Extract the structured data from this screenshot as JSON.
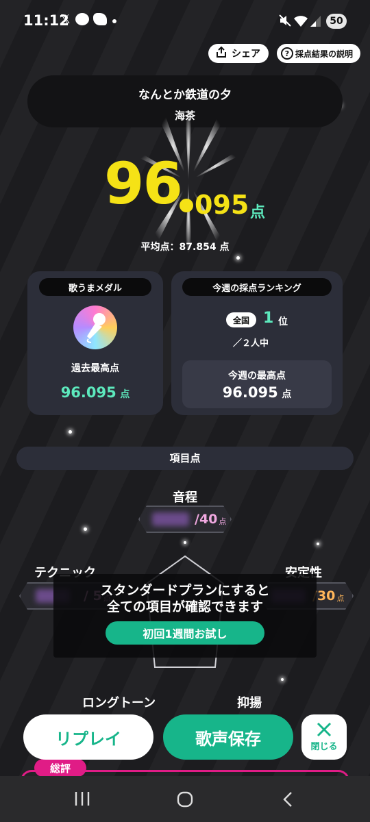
{
  "status_bar": {
    "time": "11:12",
    "app_icons": [
      "x-icon",
      "line-icon",
      "bird-icon"
    ],
    "battery": "50"
  },
  "header": {
    "share_label": "シェア",
    "explain_label": "採点結果の説明"
  },
  "song": {
    "title": "なんとか鉄道の夕",
    "artist": "海茶"
  },
  "score": {
    "integer": "96",
    "decimal": "095",
    "unit": "点",
    "average": "平均点：87.854 点"
  },
  "medal_card": {
    "tag": "歌うまメダル",
    "best_label": "過去最高点",
    "best_value": "96.095",
    "unit": "点"
  },
  "ranking_card": {
    "tag": "今週の採点ランキング",
    "scope": "全国",
    "rank": "1",
    "rank_unit": "位",
    "out_of": "／２人中",
    "week_best_label": "今週の最高点",
    "week_best_value": "96.095",
    "unit": "点"
  },
  "items": {
    "section_title": "項目点",
    "pitch": {
      "label": "音程",
      "max": "/40",
      "unit": "点"
    },
    "technique": {
      "label": "テクニック",
      "max": "/ 5",
      "unit": "点"
    },
    "stability": {
      "label": "安定性",
      "max": "/30",
      "unit": "点"
    },
    "long_tone": {
      "label": "ロングトーン"
    },
    "intonation": {
      "label": "抑揚"
    }
  },
  "upsell": {
    "line1": "スタンダードプランにすると",
    "line2": "全ての項目が確認できます",
    "button": "初回1週間お試し"
  },
  "actions": {
    "replay": "リプレイ",
    "save": "歌声保存",
    "close": "閉じる"
  },
  "summary": {
    "tag": "総評"
  },
  "colors": {
    "accent": "#17b58a",
    "score_yellow": "#f5e216",
    "summary_pink": "#e01c86"
  }
}
